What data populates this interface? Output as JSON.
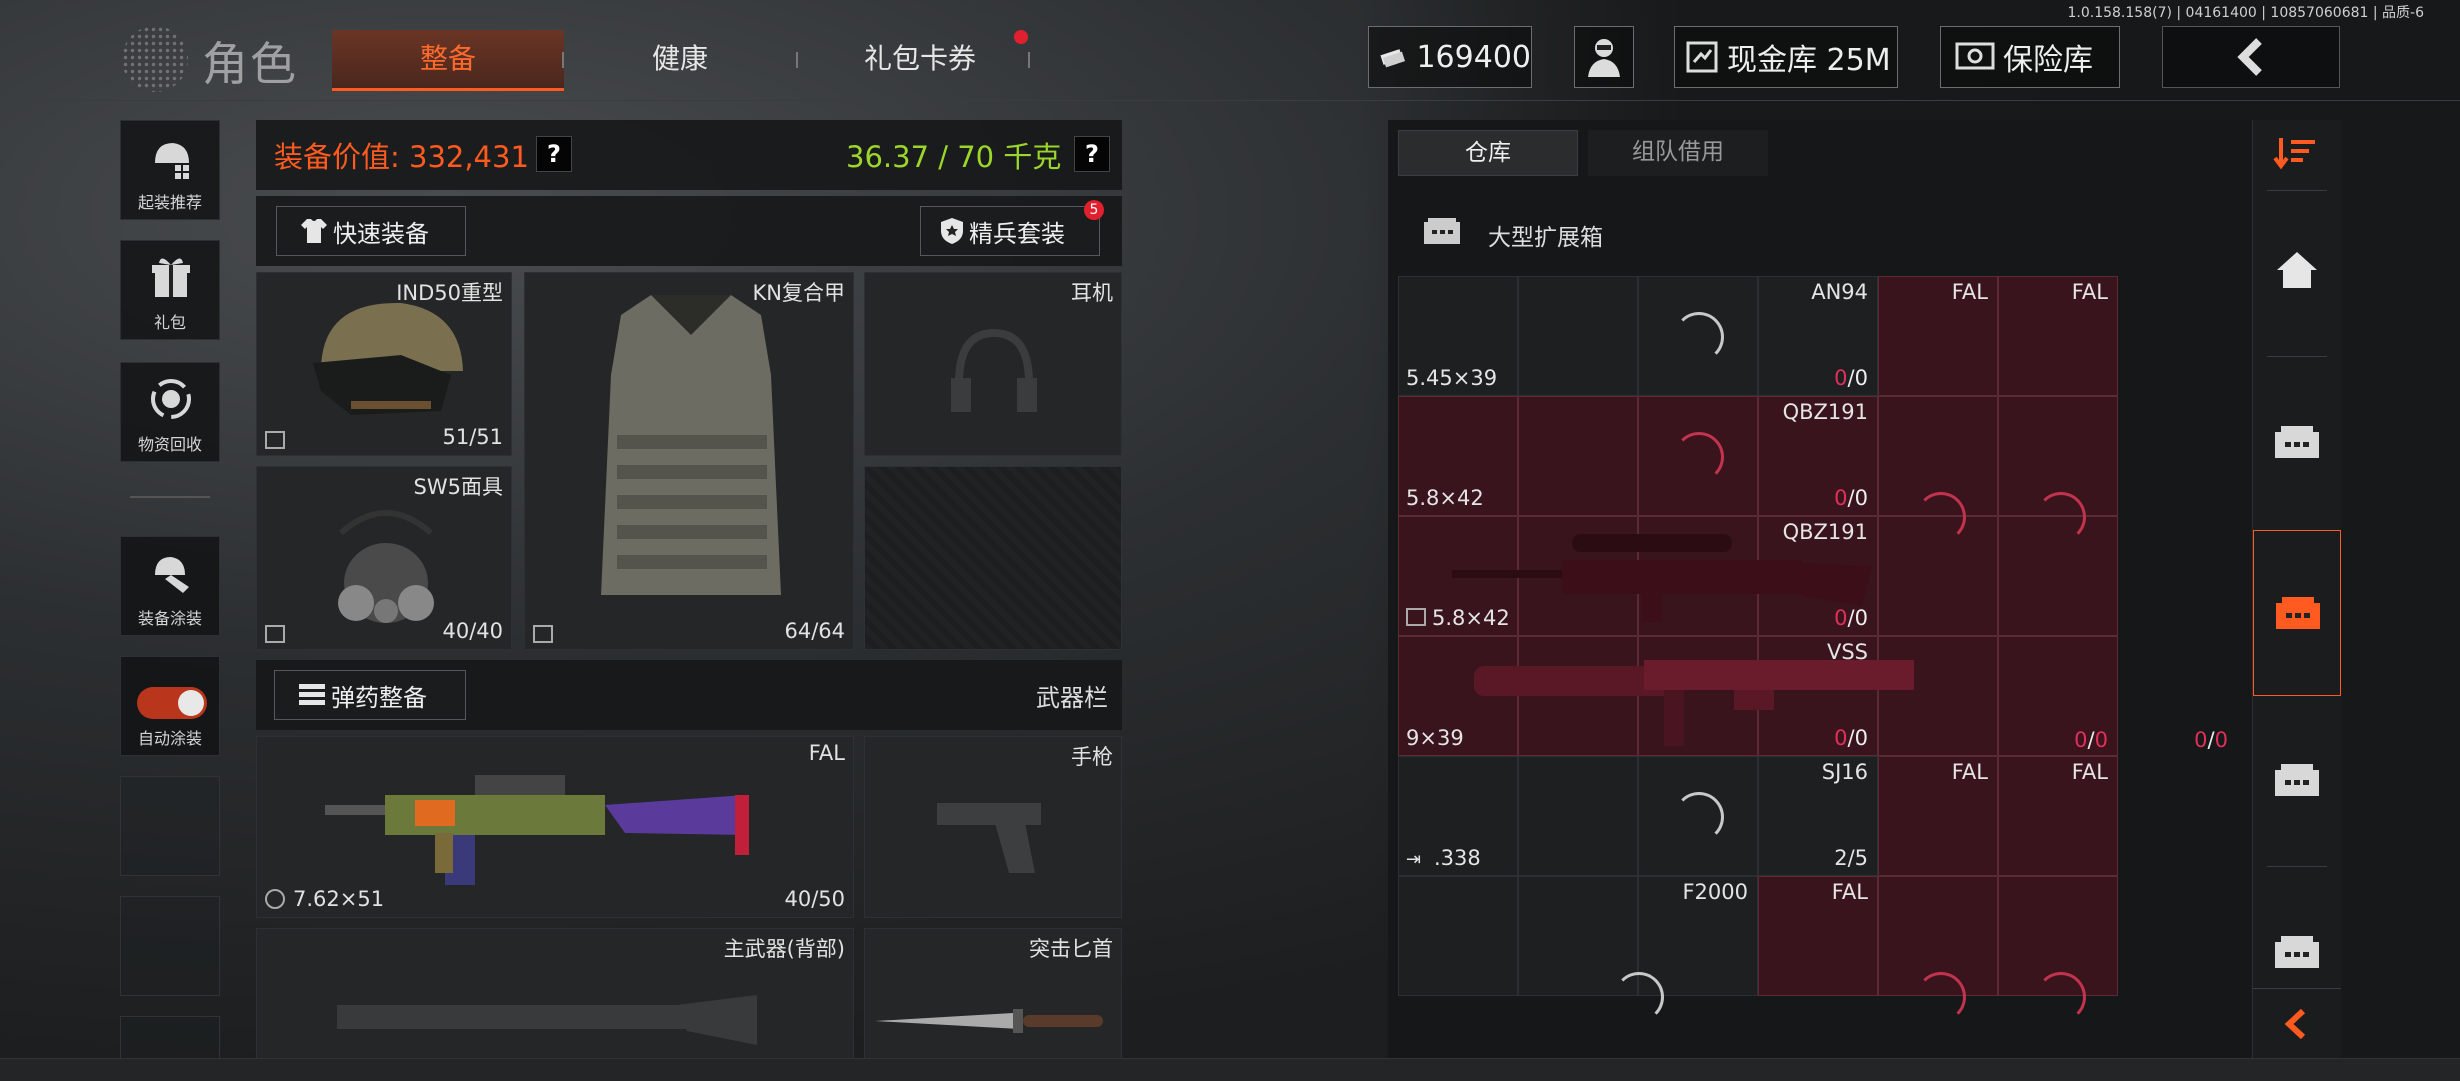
{
  "build_info": "1.0.158.158(7) | 04161400 | 10857060681 | 品质-6",
  "header": {
    "title": "角色",
    "tabs": [
      {
        "label": "整备",
        "active": true
      },
      {
        "label": "健康",
        "active": false
      },
      {
        "label": "礼包卡券",
        "active": false,
        "dot": true
      }
    ],
    "money": "169400",
    "cash_vault": "现金库 25M",
    "safe_vault": "保险库"
  },
  "sidebar": {
    "items": [
      {
        "label": "起装推荐",
        "icon": "helmet-gear-icon"
      },
      {
        "label": "礼包",
        "icon": "gift-icon"
      },
      {
        "label": "物资回收",
        "icon": "recycle-icon"
      },
      {
        "label": "装备涂装",
        "icon": "paint-gear-icon"
      },
      {
        "label": "自动涂装",
        "icon": "toggle-icon",
        "toggle_on": true
      }
    ]
  },
  "equipment": {
    "value_label": "装备价值: 332,431",
    "weight_label": "36.37 / 70 千克",
    "help": "?",
    "quick_equip": "快速装备",
    "elite_set": "精兵套装",
    "elite_badge": "5",
    "helmet": {
      "name": "IND50重型",
      "durability": "51/51"
    },
    "armor": {
      "name": "KN复合甲",
      "durability": "64/64"
    },
    "headset": {
      "name": "耳机"
    },
    "mask": {
      "name": "SW5面具",
      "durability": "40/40"
    },
    "ammo_sort": "弹药整备",
    "weapon_bar": "武器栏",
    "primary": {
      "name": "FAL",
      "caliber": "7.62×51",
      "ammo": "40/50"
    },
    "pistol": {
      "name": "手枪"
    },
    "backup": {
      "name": "主武器(背部)"
    },
    "knife": {
      "name": "突击匕首"
    }
  },
  "warehouse": {
    "tabs": [
      {
        "label": "仓库",
        "active": true
      },
      {
        "label": "组队借用",
        "active": false
      }
    ],
    "container": "大型扩展箱",
    "rows": [
      {
        "name": "AN94",
        "caliber": "5.45×39",
        "ammo_a": "0",
        "ammo_b": "0",
        "side": [
          "FAL",
          "FAL"
        ]
      },
      {
        "name": "QBZ191",
        "caliber": "5.8×42",
        "ammo_a": "0",
        "ammo_b": "0"
      },
      {
        "name": "QBZ191",
        "caliber": "5.8×42",
        "ammo_a": "0",
        "ammo_b": "0"
      },
      {
        "name": "VSS",
        "caliber": "9×39",
        "ammo_a": "0",
        "ammo_b": "0",
        "extra1_a": "0",
        "extra1_b": "0",
        "extra2_a": "0",
        "extra2_b": "0"
      },
      {
        "name": "SJ16",
        "caliber": ".338",
        "ammo": "2/5",
        "side": [
          "FAL",
          "FAL"
        ]
      },
      {
        "name": "F2000",
        "side": [
          "FAL"
        ]
      }
    ]
  },
  "colors": {
    "accent": "#ff5a1f",
    "weight_green": "#9bd62a",
    "pink_bg": "#3a141c",
    "ammo_red": "#e0305a"
  }
}
